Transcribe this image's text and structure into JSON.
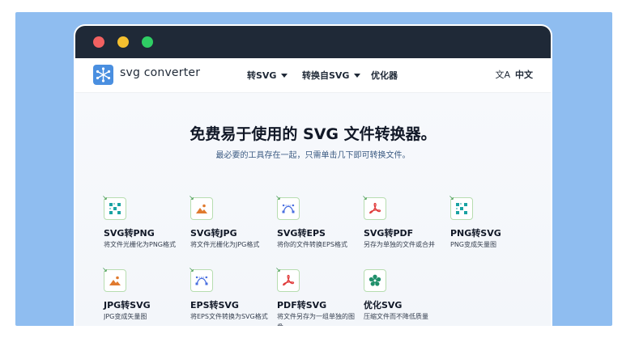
{
  "window": {
    "controls": [
      "close",
      "minimize",
      "maximize"
    ]
  },
  "nav": {
    "logo_text": "svg converter",
    "items": [
      {
        "label": "转SVG",
        "has_caret": true
      },
      {
        "label": "转换自SVG",
        "has_caret": true
      },
      {
        "label": "优化器",
        "has_caret": false
      }
    ],
    "language_label": "中文",
    "language_icon": "translate-icon"
  },
  "hero": {
    "title": "免费易于使用的 SVG 文件转换器。",
    "subtitle": "最必要的工具存在一起，只需单击几下即可转换文件。"
  },
  "tools": [
    {
      "title": "SVG转PNG",
      "desc": "将文件光栅化为PNG格式",
      "icon": "grid-icon",
      "icon_color": "#1aa3a3"
    },
    {
      "title": "SVG转JPG",
      "desc": "将文件光栅化为JPG格式",
      "icon": "image-icon",
      "icon_color": "#e07a2e"
    },
    {
      "title": "SVG转EPS",
      "desc": "将你的文件转换EPS格式",
      "icon": "bezier-icon",
      "icon_color": "#4a6fe0"
    },
    {
      "title": "SVG转PDF",
      "desc": "另存为单独的文件或合并",
      "icon": "pdf-icon",
      "icon_color": "#e03a3a"
    },
    {
      "title": "PNG转SVG",
      "desc": "PNG变成矢量图",
      "icon": "grid-icon",
      "icon_color": "#1aa3a3"
    },
    {
      "title": "JPG转SVG",
      "desc": "JPG变成矢量图",
      "icon": "image-icon",
      "icon_color": "#e07a2e"
    },
    {
      "title": "EPS转SVG",
      "desc": "将EPS文件转换为SVG格式",
      "icon": "bezier-icon",
      "icon_color": "#4a6fe0"
    },
    {
      "title": "PDF转SVG",
      "desc": "将文件另存为一组单独的图像",
      "icon": "pdf-icon",
      "icon_color": "#e03a3a"
    },
    {
      "title": "优化SVG",
      "desc": "压缩文件而不降低质量",
      "icon": "flower-icon",
      "icon_color": "#1f8f6a"
    }
  ]
}
